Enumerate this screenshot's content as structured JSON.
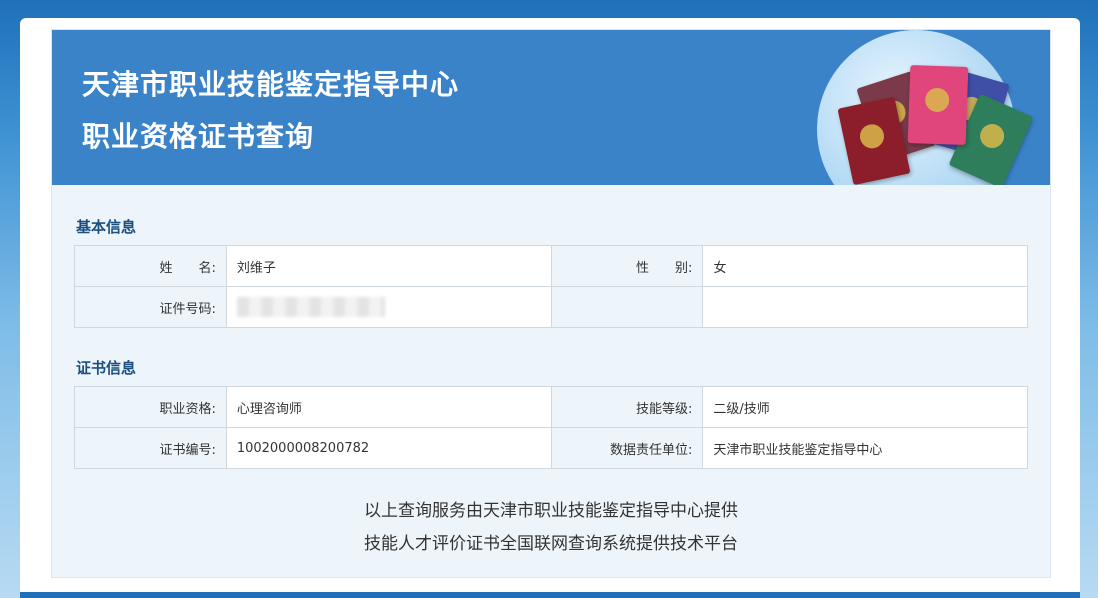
{
  "banner": {
    "title_line1": "天津市职业技能鉴定指导中心",
    "title_line2": "职业资格证书查询"
  },
  "basic_info": {
    "section_title": "基本信息",
    "name_label": "姓　　名:",
    "name_value": "刘维子",
    "gender_label": "性　　别:",
    "gender_value": "女",
    "id_label": "证件号码:",
    "id_value": ""
  },
  "cert_info": {
    "section_title": "证书信息",
    "qualification_label": "职业资格:",
    "qualification_value": "心理咨询师",
    "level_label": "技能等级:",
    "level_value": "二级/技师",
    "cert_no_label": "证书编号:",
    "cert_no_value": "1002000008200782",
    "unit_label": "数据责任单位:",
    "unit_value": "天津市职业技能鉴定指导中心"
  },
  "footer": {
    "line1": "以上查询服务由天津市职业技能鉴定指导中心提供",
    "line2": "技能人才评价证书全国联网查询系统提供技术平台"
  },
  "colors": {
    "banner_bg": "#3a83c9",
    "section_title": "#1a4f80",
    "book_red": "#8c1d2a",
    "book_pink": "#e0457b",
    "book_blue": "#3f4fa8",
    "book_green": "#2e7d5b",
    "book_brown": "#7a3a4a"
  }
}
